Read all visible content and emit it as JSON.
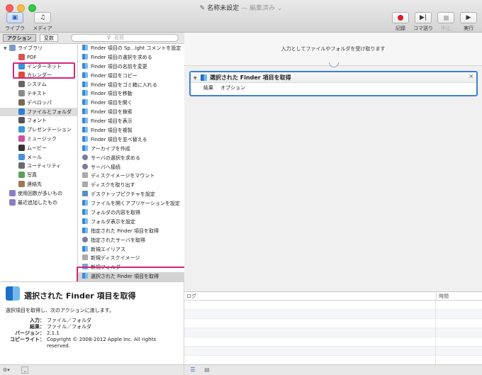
{
  "window": {
    "title": "名称未設定",
    "subtitle": "— 編集済み ⌄"
  },
  "toolbar": {
    "library": "ライブラリ",
    "media": "メディア",
    "record": "記録",
    "step": "コマ送り",
    "stop": "中止",
    "run": "実行"
  },
  "left_header": {
    "actions_tab": "アクション",
    "variables_tab": "変数",
    "search_placeholder": "名前"
  },
  "library": {
    "root": "ライブラリ",
    "items": [
      {
        "label": "PDF",
        "icon": "pdf-icon",
        "color": "#d9534f"
      },
      {
        "label": "インターネット",
        "icon": "globe-icon",
        "color": "#3a8fd8"
      },
      {
        "label": "カレンダー",
        "icon": "calendar-icon",
        "color": "#e04b3c"
      },
      {
        "label": "システム",
        "icon": "gear-icon",
        "color": "#666666"
      },
      {
        "label": "テキスト",
        "icon": "text-icon",
        "color": "#8a8a8a"
      },
      {
        "label": "デベロッパ",
        "icon": "hammer-icon",
        "color": "#7a6a55"
      },
      {
        "label": "ファイルとフォルダ",
        "icon": "finder-icon",
        "color": "#2e7fd4"
      },
      {
        "label": "フォント",
        "icon": "font-icon",
        "color": "#555555"
      },
      {
        "label": "プレゼンテーション",
        "icon": "presentation-icon",
        "color": "#3a9ad9"
      },
      {
        "label": "ミュージック",
        "icon": "music-icon",
        "color": "#cf4fa0"
      },
      {
        "label": "ムービー",
        "icon": "movie-icon",
        "color": "#333333"
      },
      {
        "label": "メール",
        "icon": "mail-icon",
        "color": "#4a90d9"
      },
      {
        "label": "ユーティリティ",
        "icon": "tools-icon",
        "color": "#6a6a6a"
      },
      {
        "label": "写真",
        "icon": "photo-icon",
        "color": "#5aa05a"
      },
      {
        "label": "連絡先",
        "icon": "contacts-icon",
        "color": "#a07850"
      }
    ],
    "extras": [
      {
        "label": "使用回数が多いもの",
        "icon": "smart-folder-icon",
        "color": "#8e7cc3"
      },
      {
        "label": "最近追加したもの",
        "icon": "smart-folder-icon",
        "color": "#8e7cc3"
      }
    ]
  },
  "actions": [
    {
      "label": "Finder 項目の Sp...ight コメントを設定",
      "kind": "finder"
    },
    {
      "label": "Finder 項目の選択を求める",
      "kind": "finder"
    },
    {
      "label": "Finder 項目の名前を変更",
      "kind": "finder"
    },
    {
      "label": "Finder 項目をコピー",
      "kind": "finder"
    },
    {
      "label": "Finder 項目をゴミ箱に入れる",
      "kind": "finder"
    },
    {
      "label": "Finder 項目を移動",
      "kind": "finder"
    },
    {
      "label": "Finder 項目を開く",
      "kind": "finder"
    },
    {
      "label": "Finder 項目を検索",
      "kind": "finder"
    },
    {
      "label": "Finder 項目を表示",
      "kind": "finder"
    },
    {
      "label": "Finder 項目を複製",
      "kind": "finder"
    },
    {
      "label": "Finder 項目を並べ替える",
      "kind": "finder"
    },
    {
      "label": "アーカイブを作成",
      "kind": "finder"
    },
    {
      "label": "サーバの選択を求める",
      "kind": "server"
    },
    {
      "label": "サーバへ接続",
      "kind": "server"
    },
    {
      "label": "ディスクイメージをマウント",
      "kind": "disk"
    },
    {
      "label": "ディスクを取り出す",
      "kind": "disk"
    },
    {
      "label": "デスクトップピクチャを設定",
      "kind": "pic"
    },
    {
      "label": "ファイルを開くアプリケーションを設定",
      "kind": "finder"
    },
    {
      "label": "フォルダの内容を取得",
      "kind": "finder"
    },
    {
      "label": "フォルダ表示を設定",
      "kind": "finder"
    },
    {
      "label": "指定された Finder 項目を取得",
      "kind": "finder"
    },
    {
      "label": "指定されたサーバを取得",
      "kind": "server"
    },
    {
      "label": "新規エイリアス",
      "kind": "finder"
    },
    {
      "label": "新規ディスクイメージ",
      "kind": "disk"
    },
    {
      "label": "新規フォルダ",
      "kind": "folder"
    },
    {
      "label": "選択された Finder 項目を取得",
      "kind": "finder"
    }
  ],
  "description": {
    "title": "選択された Finder 項目を取得",
    "text": "選択項目を取得し、次のアクションに渡します。",
    "input_label": "入力：",
    "input_value": "ファイル／フォルダ",
    "result_label": "結果：",
    "result_value": "ファイル／フォルダ",
    "version_label": "バージョン：",
    "version_value": "2.1.1",
    "copyright_label": "コピーライト：",
    "copyright_value": "Copyright © 2008-2012 Apple Inc.  All rights reserved."
  },
  "workflow": {
    "receives_text": "入力としてファイルやフォルダを受け取ります",
    "action_title": "選択された Finder 項目を取得",
    "close_glyph": "×",
    "tab_results": "結果",
    "tab_options": "オプション"
  },
  "log": {
    "col_log": "ログ",
    "col_time": "時間"
  }
}
